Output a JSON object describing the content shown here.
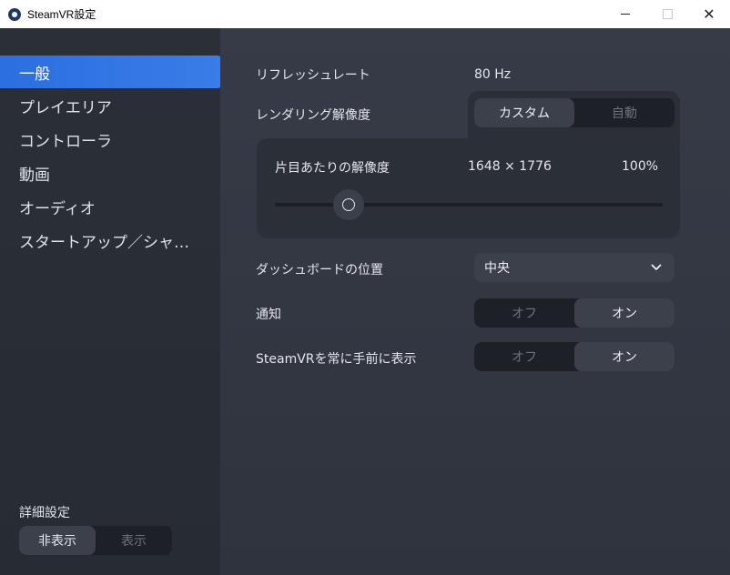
{
  "window": {
    "title": "SteamVR設定",
    "controls": {
      "close": "✕"
    }
  },
  "sidebar": {
    "items": [
      {
        "label": "一般",
        "active": true
      },
      {
        "label": "プレイエリア"
      },
      {
        "label": "コントローラ"
      },
      {
        "label": "動画"
      },
      {
        "label": "オーディオ"
      },
      {
        "label": "スタートアップ／シャットダウン"
      }
    ],
    "advanced": {
      "label": "詳細設定",
      "options": [
        "非表示",
        "表示"
      ],
      "selected": "非表示"
    }
  },
  "main": {
    "refresh_rate": {
      "label": "リフレッシュレート",
      "value": "80 Hz"
    },
    "render_resolution": {
      "label": "レンダリング解像度",
      "options": [
        "カスタム",
        "自動"
      ],
      "selected": "カスタム"
    },
    "per_eye": {
      "label": "片目あたりの解像度",
      "resolution": "1648 × 1776",
      "percent": "100%",
      "slider_fraction": 0.19
    },
    "dashboard_position": {
      "label": "ダッシュボードの位置",
      "value": "中央"
    },
    "notifications": {
      "label": "通知",
      "options": [
        "オフ",
        "オン"
      ],
      "selected": "オン"
    },
    "always_on_top": {
      "label": "SteamVRを常に手前に表示",
      "options": [
        "オフ",
        "オン"
      ],
      "selected": "オン"
    }
  },
  "colors": {
    "accent": "#2b6fe0",
    "background": "#2f3440",
    "sidebar": "#2b2f38"
  }
}
